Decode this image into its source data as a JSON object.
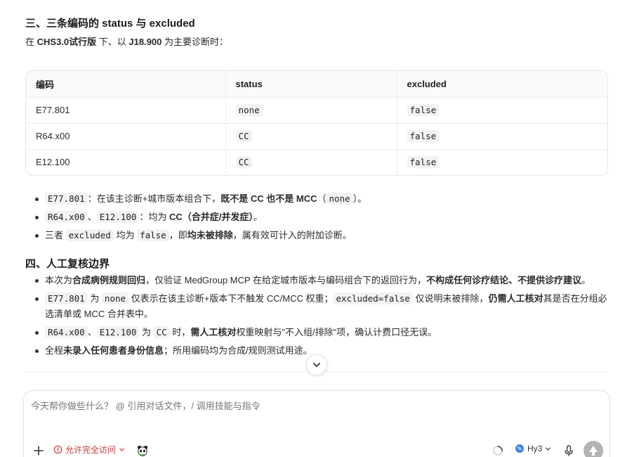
{
  "section3": {
    "heading": "三、三条编码的 status 与 excluded",
    "intro_prefix": "在 ",
    "intro_version": "CHS3.0试行版",
    "intro_mid": " 下、以 ",
    "intro_dx": "J18.900",
    "intro_suffix": " 为主要诊断时："
  },
  "table": {
    "headers": [
      "编码",
      "status",
      "excluded"
    ],
    "rows": [
      {
        "code": "E77.801",
        "status": "none",
        "excluded": "false"
      },
      {
        "code": "R64.x00",
        "status": "CC",
        "excluded": "false"
      },
      {
        "code": "E12.100",
        "status": "CC",
        "excluded": "false"
      }
    ]
  },
  "bullets3": {
    "b1_code": "E77.801",
    "b1_t1": "：在该主诊断+城市版本组合下，",
    "b1_bold": "既不是 CC 也不是 MCC",
    "b1_t2": "（",
    "b1_code2": "none",
    "b1_t3": "）。",
    "b2_code1": "R64.x00",
    "b2_sep": "、",
    "b2_code2": "E12.100",
    "b2_t1": "：均为 ",
    "b2_bold": "CC（合并症/并发症）",
    "b2_t2": "。",
    "b3_t1": "三者 ",
    "b3_code1": "excluded",
    "b3_t2": " 均为 ",
    "b3_code2": "false",
    "b3_t3": "，即",
    "b3_bold": "均未被排除",
    "b3_t4": "，属有效可计入的附加诊断。"
  },
  "section4": {
    "heading": "四、人工复核边界",
    "b1_t1": "本次为",
    "b1_bold1": "合成病例规则回归",
    "b1_t2": "，仅验证 MedGroup MCP 在给定城市版本与编码组合下的返回行为，",
    "b1_bold2": "不构成任何诊疗结论、不提供诊疗建议",
    "b1_t3": "。",
    "b2_code1": "E77.801",
    "b2_t1": " 为 ",
    "b2_code2": "none",
    "b2_t2": " 仅表示在该主诊断+版本下不触发 CC/MCC 权重；",
    "b2_code3": "excluded=false",
    "b2_t3": " 仅说明未被排除，",
    "b2_bold": "仍需人工核对",
    "b2_t4": "其是否在分组必选清单或 MCC 合并表中。",
    "b3_code1": "R64.x00",
    "b3_sep": "、",
    "b3_code2": "E12.100",
    "b3_t1": " 为 ",
    "b3_code3": "CC",
    "b3_t2": " 时，",
    "b3_bold": "需人工核对",
    "b3_t3": "权重映射与\"不入组/排除\"项，确认计费口径无误。",
    "b4_t1": "全程",
    "b4_bold": "未录入任何患者身份信息",
    "b4_t2": "；所用编码均为合成/规则测试用途。"
  },
  "composer": {
    "placeholder": "今天帮你做些什么？ @ 引用对话文件，/ 调用技能与指令",
    "access_label": "允许完全访问",
    "model_label": "Hy3"
  },
  "icons": {
    "scroll_down": "chevron-down-icon",
    "add": "plus-icon",
    "access": "alert-circle-icon",
    "agent": "panda-icon",
    "loading": "spinner-icon",
    "model": "globe-icon",
    "mic": "microphone-icon",
    "send": "arrow-up-icon"
  },
  "colors": {
    "access_red": "#c93c3c",
    "send_button": "#b3b3b3"
  }
}
